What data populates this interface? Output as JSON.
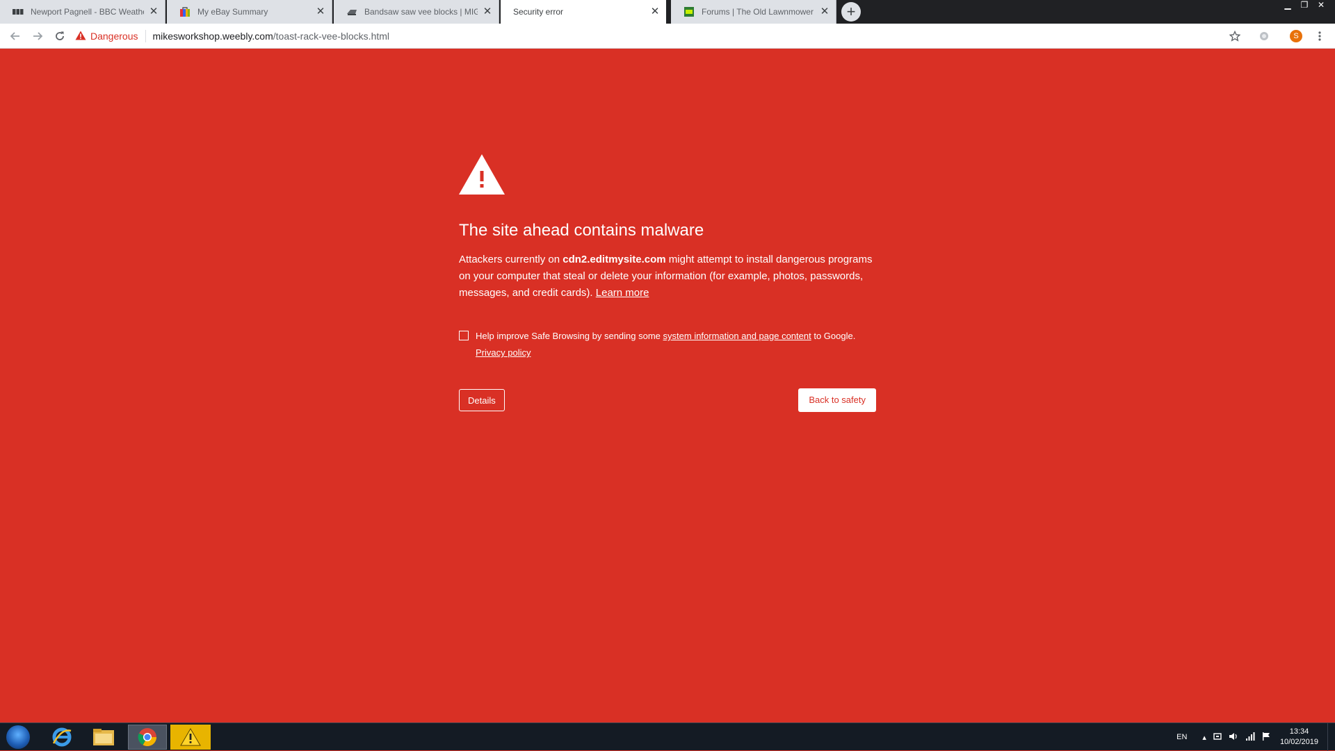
{
  "browser": {
    "tabs": [
      {
        "title": "Newport Pagnell - BBC Weather",
        "icon": "bbc-icon"
      },
      {
        "title": "My eBay Summary",
        "icon": "ebay-icon"
      },
      {
        "title": "Bandsaw saw vee blocks | MIG W",
        "icon": "site-icon"
      },
      {
        "title": "Security error",
        "icon": "blank-icon"
      },
      {
        "title": "Forums | The Old Lawnmower Cl",
        "icon": "olc-icon"
      }
    ],
    "active_tab": 3,
    "address_bar": {
      "security_label": "Dangerous",
      "host": "mikesworkshop.weebly.com",
      "path": "/toast-rack-vee-blocks.html"
    },
    "profile_initial": "S"
  },
  "interstitial": {
    "heading": "The site ahead contains malware",
    "body_prefix": "Attackers currently on ",
    "body_domain": "cdn2.editmysite.com",
    "body_suffix": " might attempt to install dangerous programs on your computer that steal or delete your information (for example, photos, passwords, messages, and credit cards). ",
    "learn_more": "Learn more",
    "optin_prefix": "Help improve Safe Browsing by sending some ",
    "optin_link": "system information and page content",
    "optin_suffix": " to Google.",
    "privacy_policy": "Privacy policy",
    "details_button": "Details",
    "back_button": "Back to safety",
    "background_color": "#d93025"
  },
  "taskbar": {
    "language": "EN",
    "time": "13:34",
    "date": "10/02/2019"
  }
}
